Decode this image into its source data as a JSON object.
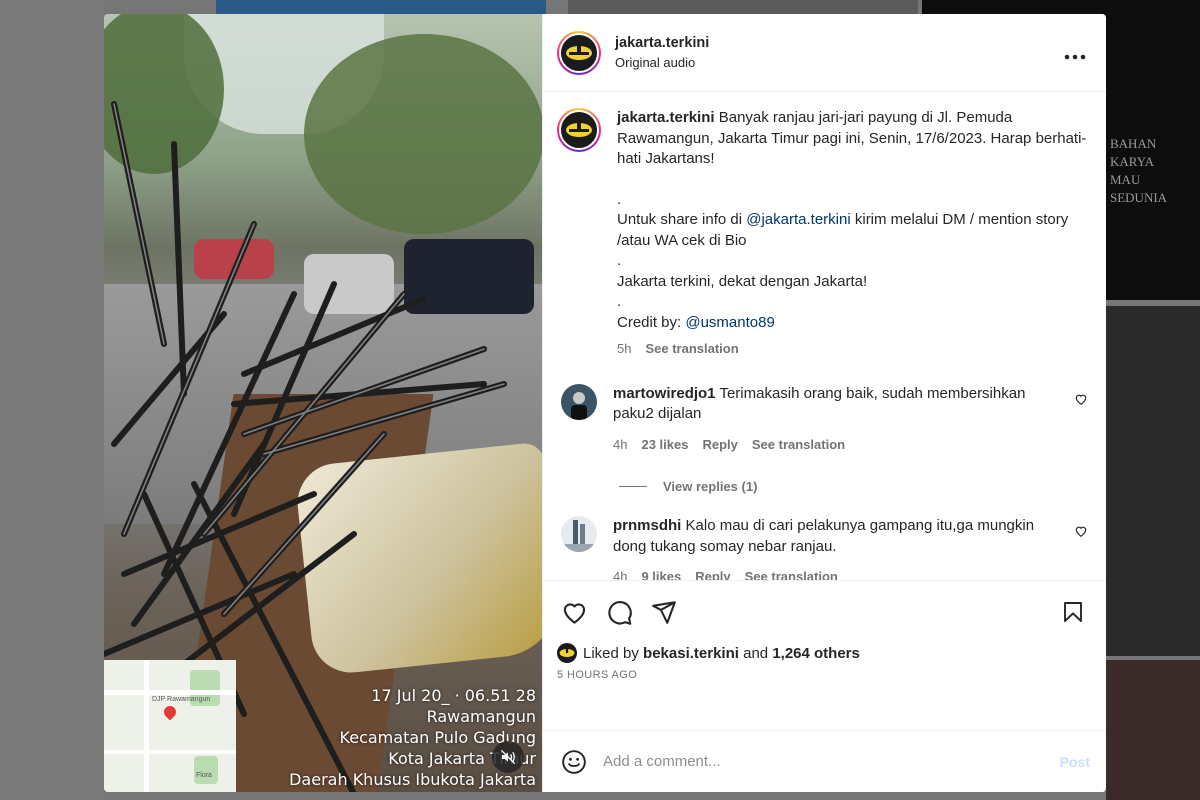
{
  "backdrop": {
    "side_text_line1": "BAHAN KARYA",
    "side_text_line2": "MAU SEDUNIA"
  },
  "media": {
    "timestamp_lines": [
      "17 Jul 20_ · 06.51 28",
      "Rawamangun",
      "Kecamatan Pulo Gadung",
      "Kota Jakarta Timur",
      "Daerah Khusus Ibukota Jakarta"
    ],
    "map_labels": [
      "DJP Rawamangun",
      "Flora"
    ],
    "mute_icon": "speaker-muted-icon"
  },
  "post": {
    "username": "jakarta.terkini",
    "audio_label": "Original audio",
    "more_icon": "more-horizontal-icon",
    "caption": {
      "username": "jakarta.terkini",
      "text_1": "Banyak ranjau jari-jari payung di Jl. Pemuda Rawamangun, Jakarta Timur pagi ini, Senin, 17/6/2023. Harap berhati-hati Jakartans!",
      "dot_1": ".",
      "text_2_pre": "Untuk share info di ",
      "mention_1": "@jakarta.terkini",
      "text_2_post": " kirim melalui DM / mention story /atau WA cek di Bio",
      "dot_2": ".",
      "text_3": "Jakarta terkini, dekat dengan Jakarta!",
      "dot_3": ".",
      "credit_pre": "Credit by: ",
      "mention_2": "@usmanto89",
      "time": "5h",
      "see_translation": "See translation"
    },
    "comments": [
      {
        "username": "martowiredjo1",
        "text": "Terimakasih orang baik, sudah membersihkan paku2 dijalan",
        "time": "4h",
        "likes": "23 likes",
        "reply": "Reply",
        "see_translation": "See translation",
        "view_replies": "View replies (1)"
      },
      {
        "username": "prnmsdhi",
        "text": "Kalo mau di cari pelakunya gampang itu,ga mungkin dong tukang somay nebar ranjau.",
        "time": "4h",
        "likes": "9 likes",
        "reply": "Reply",
        "see_translation": "See translation"
      }
    ],
    "actions": {
      "icons": [
        "heart-icon",
        "comment-icon",
        "share-icon",
        "bookmark-icon"
      ]
    },
    "liked_by": {
      "prefix": "Liked by ",
      "user": "bekasi.terkini",
      "middle": " and ",
      "count": "1,264 others"
    },
    "posted_time": "5 HOURS AGO",
    "add_comment": {
      "placeholder": "Add a comment...",
      "post_label": "Post",
      "emoji_icon": "emoji-icon"
    }
  },
  "colors": {
    "text": "#262626",
    "muted": "#737373",
    "link": "#00376b",
    "post_disabled": "#c7e1fc"
  }
}
